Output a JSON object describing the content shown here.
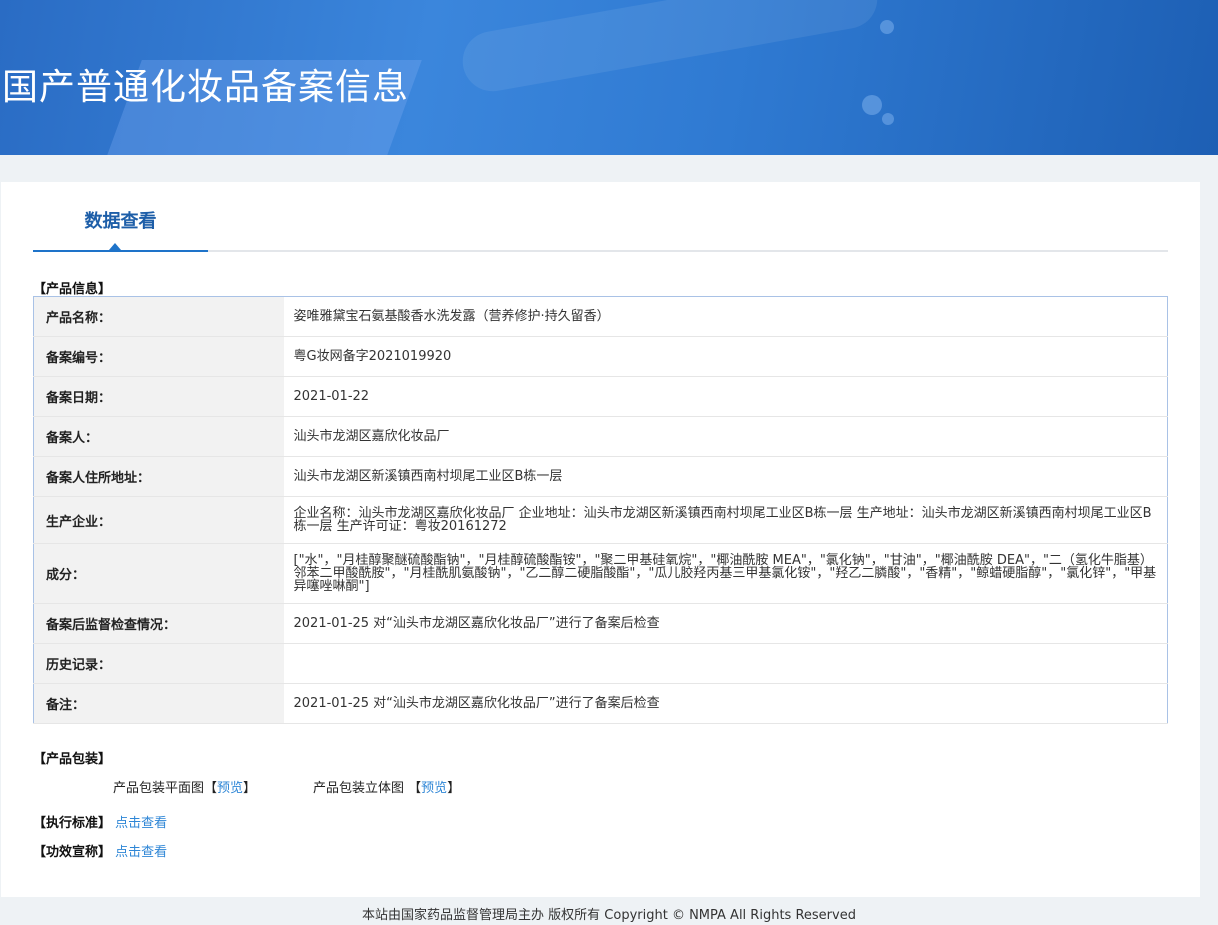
{
  "banner": {
    "title": "国产普通化妆品备案信息"
  },
  "tab": {
    "label": "数据查看"
  },
  "sections": {
    "product_info": "【产品信息】",
    "packaging": "【产品包装】",
    "standard": "【执行标准】",
    "efficacy": "【功效宣称】"
  },
  "rows": [
    {
      "label": "产品名称：",
      "value": "姿唯雅黛宝石氨基酸香水洗发露（营养修护·持久留香）"
    },
    {
      "label": "备案编号：",
      "value": "粤G妆网备字2021019920"
    },
    {
      "label": "备案日期：",
      "value": "2021-01-22"
    },
    {
      "label": "备案人：",
      "value": "汕头市龙湖区嘉欣化妆品厂"
    },
    {
      "label": "备案人住所地址：",
      "value": "汕头市龙湖区新溪镇西南村坝尾工业区B栋一层"
    },
    {
      "label": "生产企业：",
      "value": "企业名称：汕头市龙湖区嘉欣化妆品厂 企业地址：汕头市龙湖区新溪镇西南村坝尾工业区B栋一层 生产地址：汕头市龙湖区新溪镇西南村坝尾工业区B栋一层 生产许可证：粤妆20161272"
    },
    {
      "label": "成分：",
      "value": "[\"水\"，\"月桂醇聚醚硫酸酯钠\"，\"月桂醇硫酸酯铵\"，\"聚二甲基硅氧烷\"，\"椰油酰胺 MEA\"，\"氯化钠\"，\"甘油\"，\"椰油酰胺 DEA\"，\"二（氢化牛脂基）邻苯二甲酸酰胺\"，\"月桂酰肌氨酸钠\"，\"乙二醇二硬脂酸酯\"，\"瓜儿胶羟丙基三甲基氯化铵\"，\"羟乙二膦酸\"，\"香精\"，\"鲸蜡硬脂醇\"，\"氯化锌\"，\"甲基异噻唑啉酮\"]"
    },
    {
      "label": "备案后监督检查情况：",
      "value": "2021-01-25 对“汕头市龙湖区嘉欣化妆品厂”进行了备案后检查"
    },
    {
      "label": "历史记录：",
      "value": ""
    },
    {
      "label": "备注：",
      "value": "2021-01-25 对“汕头市龙湖区嘉欣化妆品厂”进行了备案后检查"
    }
  ],
  "packaging": {
    "flat_label": "产品包装平面图",
    "solid_label": "产品包装立体图",
    "preview": "预览",
    "lb": "【",
    "rb": "】"
  },
  "links": {
    "view": "点击查看"
  },
  "footer": "本站由国家药品监督管理局主办 版权所有 Copyright © NMPA All Rights Reserved"
}
